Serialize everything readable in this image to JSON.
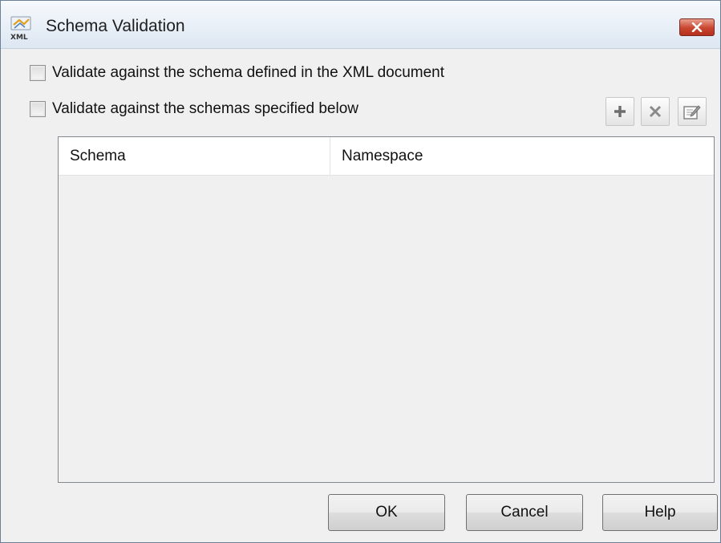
{
  "window": {
    "title": "Schema Validation",
    "icon": "xml-schema-icon"
  },
  "options": {
    "validate_document_label": "Validate against the schema defined in the XML document",
    "validate_document_checked": false,
    "validate_specified_label": "Validate against the schemas specified below",
    "validate_specified_checked": false
  },
  "toolbar": {
    "buttons": [
      {
        "name": "add",
        "icon": "plus-icon"
      },
      {
        "name": "remove",
        "icon": "x-icon"
      },
      {
        "name": "edit",
        "icon": "edit-icon"
      }
    ]
  },
  "table": {
    "columns": [
      "Schema",
      "Namespace"
    ],
    "rows": []
  },
  "buttons": {
    "ok": "OK",
    "cancel": "Cancel",
    "help": "Help"
  }
}
